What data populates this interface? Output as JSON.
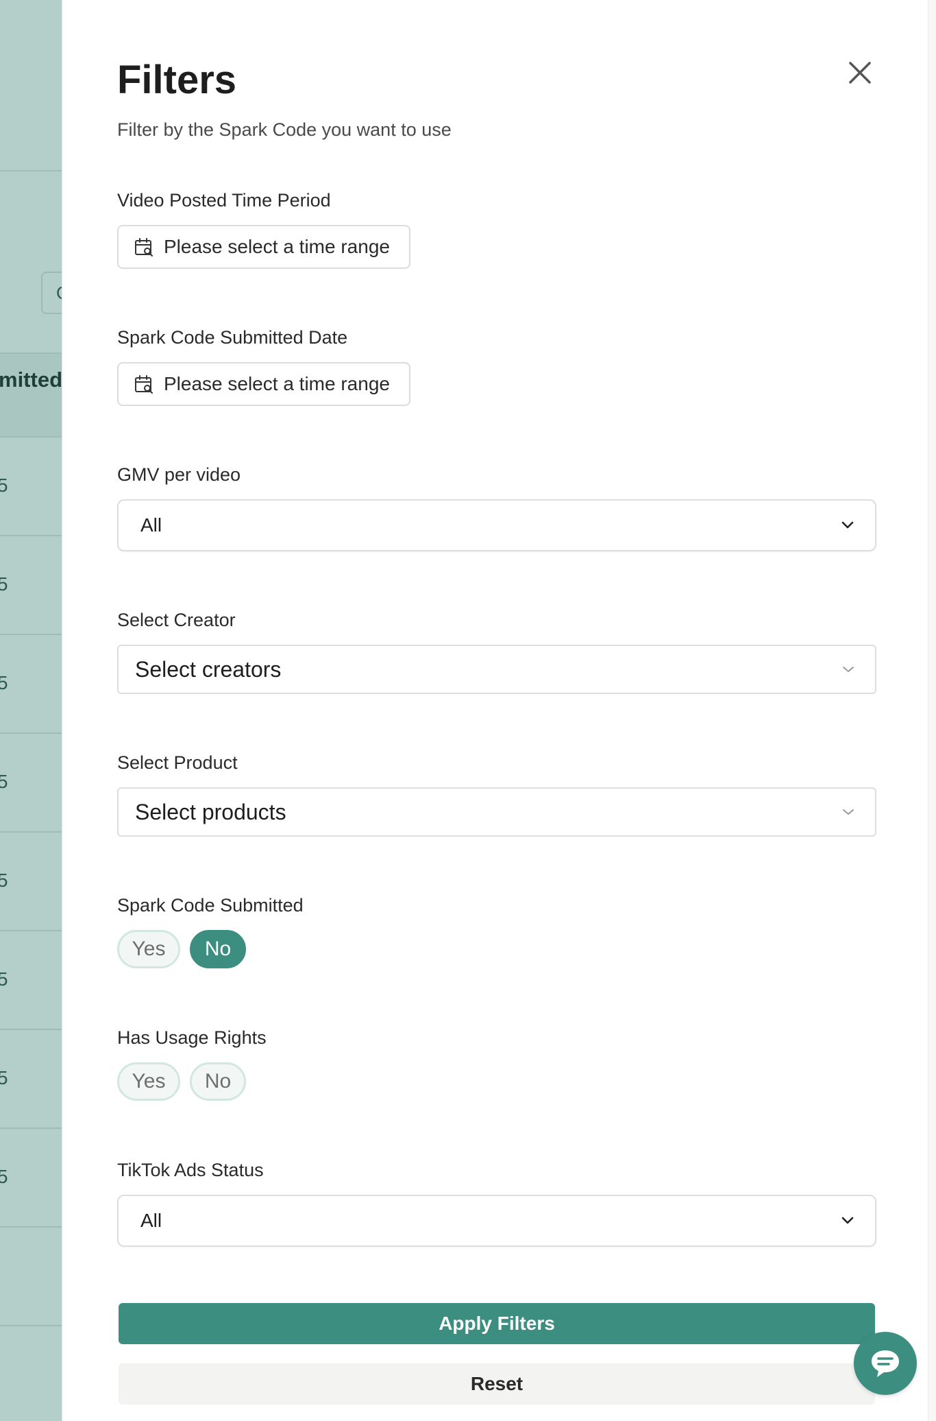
{
  "backdrop": {
    "header_text": "mitted",
    "search_char": "C",
    "cell_digits": [
      "5",
      "5",
      "5",
      "5",
      "5",
      "5",
      "5",
      "5"
    ]
  },
  "drawer": {
    "title": "Filters",
    "subtitle": "Filter by the Spark Code you want to use",
    "close_icon": "close-icon"
  },
  "filters": {
    "video_posted": {
      "label": "Video Posted Time Period",
      "placeholder": "Please select a time range",
      "icon": "calendar-search-icon"
    },
    "spark_submitted_date": {
      "label": "Spark Code Submitted Date",
      "placeholder": "Please select a time range",
      "icon": "calendar-search-icon"
    },
    "gmv_per_video": {
      "label": "GMV per video",
      "value": "All"
    },
    "select_creator": {
      "label": "Select Creator",
      "placeholder": "Select creators"
    },
    "select_product": {
      "label": "Select Product",
      "placeholder": "Select products"
    },
    "spark_code_submitted": {
      "label": "Spark Code Submitted",
      "options": [
        "Yes",
        "No"
      ],
      "selected": "No"
    },
    "has_usage_rights": {
      "label": "Has Usage Rights",
      "options": [
        "Yes",
        "No"
      ],
      "selected": null
    },
    "tiktok_ads_status": {
      "label": "TikTok Ads Status",
      "value": "All"
    }
  },
  "actions": {
    "apply_label": "Apply Filters",
    "reset_label": "Reset"
  },
  "chat": {
    "icon": "chat-bubble-icon"
  },
  "colors": {
    "accent": "#3c8e81",
    "backdrop": "#b4cfc9",
    "pill_off_bg": "#f2f7f6",
    "pill_off_border": "#d2e6e2"
  }
}
